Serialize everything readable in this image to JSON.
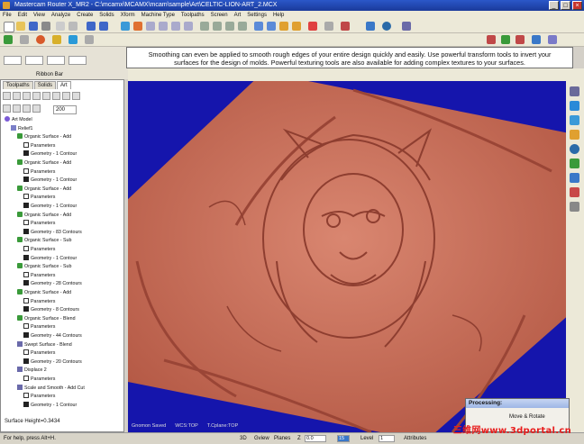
{
  "window": {
    "title": "Mastercam Router X_MR2 - C:\\mcamx\\MCAMX\\mcam\\sample\\Art\\CELTIC-LION-ART_2.MCX",
    "controls": [
      "_",
      "□",
      "×"
    ]
  },
  "menu": [
    "File",
    "Edit",
    "View",
    "Analyze",
    "Create",
    "Solids",
    "Xform",
    "Machine Type",
    "Toolpaths",
    "Screen",
    "Art",
    "Settings",
    "Help"
  ],
  "ribbon": {
    "label": "Ribbon Bar"
  },
  "tooltip": {
    "line1": "Smoothing can even be applied to smooth rough edges of your entire design quickly and easily. Use powerful transform tools to invert your",
    "line2": "surfaces for the design of molds. Powerful texturing tools are also available for adding complex textures to your surfaces."
  },
  "panel": {
    "tabs": [
      "Toolpaths",
      "Solids",
      "Art"
    ],
    "active_tab": "Art",
    "field_value": "200",
    "status": "Surface Height=0.3434"
  },
  "tree": [
    {
      "label": "Art Model",
      "level": 0,
      "icon": "lay"
    },
    {
      "label": "Relief1",
      "level": 1,
      "icon": "rel"
    },
    {
      "label": "Organic Surface - Add",
      "level": 2,
      "icon": "org"
    },
    {
      "label": "Parameters",
      "level": 3,
      "icon": "par"
    },
    {
      "label": "Geometry - 1 Contour",
      "level": 3,
      "icon": "geo"
    },
    {
      "label": "Organic Surface - Add",
      "level": 2,
      "icon": "org"
    },
    {
      "label": "Parameters",
      "level": 3,
      "icon": "par"
    },
    {
      "label": "Geometry - 1 Contour",
      "level": 3,
      "icon": "geo"
    },
    {
      "label": "Organic Surface - Add",
      "level": 2,
      "icon": "org"
    },
    {
      "label": "Parameters",
      "level": 3,
      "icon": "par"
    },
    {
      "label": "Geometry - 1 Contour",
      "level": 3,
      "icon": "geo"
    },
    {
      "label": "Organic Surface - Add",
      "level": 2,
      "icon": "org"
    },
    {
      "label": "Parameters",
      "level": 3,
      "icon": "par"
    },
    {
      "label": "Geometry - 83 Contours",
      "level": 3,
      "icon": "geo"
    },
    {
      "label": "Organic Surface - Sub",
      "level": 2,
      "icon": "org"
    },
    {
      "label": "Parameters",
      "level": 3,
      "icon": "par"
    },
    {
      "label": "Geometry - 1 Contour",
      "level": 3,
      "icon": "geo"
    },
    {
      "label": "Organic Surface - Sub",
      "level": 2,
      "icon": "org"
    },
    {
      "label": "Parameters",
      "level": 3,
      "icon": "par"
    },
    {
      "label": "Geometry - 28 Contours",
      "level": 3,
      "icon": "geo"
    },
    {
      "label": "Organic Surface - Add",
      "level": 2,
      "icon": "org"
    },
    {
      "label": "Parameters",
      "level": 3,
      "icon": "par"
    },
    {
      "label": "Geometry - 8 Contours",
      "level": 3,
      "icon": "geo"
    },
    {
      "label": "Organic Surface - Blend",
      "level": 2,
      "icon": "org"
    },
    {
      "label": "Parameters",
      "level": 3,
      "icon": "par"
    },
    {
      "label": "Geometry - 44 Contours",
      "level": 3,
      "icon": "geo"
    },
    {
      "label": "Swept Surface - Blend",
      "level": 2,
      "icon": "tool"
    },
    {
      "label": "Parameters",
      "level": 3,
      "icon": "par"
    },
    {
      "label": "Geometry - 20 Contours",
      "level": 3,
      "icon": "geo"
    },
    {
      "label": "Displace 2",
      "level": 2,
      "icon": "tool"
    },
    {
      "label": "Parameters",
      "level": 3,
      "icon": "par"
    },
    {
      "label": "Scale and Smooth - Add Cut",
      "level": 2,
      "icon": "tool"
    },
    {
      "label": "Parameters",
      "level": 3,
      "icon": "par"
    },
    {
      "label": "Geometry - 1 Contour",
      "level": 3,
      "icon": "geo"
    }
  ],
  "viewport": {
    "status_gnomon": "Gnomon Saved",
    "status_wcs": "WCS:TOP",
    "status_cplane": "T.Cplane:TOP",
    "background": "#1515ac",
    "relief_color": "#cc705a"
  },
  "bottom": {
    "help": "For help, press Alt+H.",
    "mode": "3D",
    "gview": "Gview",
    "planes": "Planes",
    "z_label": "Z",
    "z_value": "0.0",
    "color_value": "15",
    "level_label": "Level",
    "level_value": "1",
    "attributes": "Attributes"
  },
  "processing": {
    "title": "Processing:",
    "message": "Move & Rotate"
  },
  "watermark": "三维网www.3dportal.cn"
}
